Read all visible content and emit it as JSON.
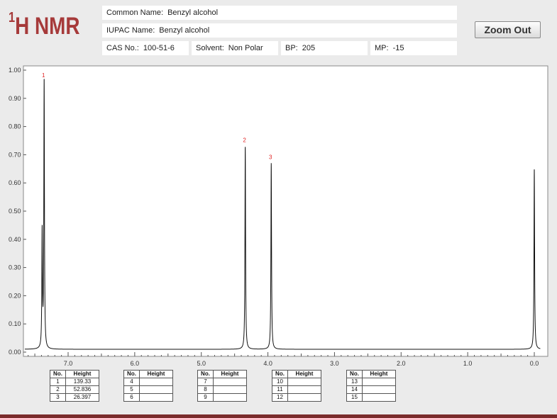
{
  "header": {
    "logo_sup": "1",
    "logo_text": "H NMR",
    "common_name_label": "Common Name:",
    "common_name": "Benzyl alcohol",
    "iupac_label": "IUPAC Name:",
    "iupac_name": "Benzyl alcohol",
    "cas_label": "CAS No.:",
    "cas": "100-51-6",
    "solvent_label": "Solvent:",
    "solvent": "Non Polar",
    "bp_label": "BP:",
    "bp": "205",
    "mp_label": "MP:",
    "mp": "-15",
    "zoom_out_label": "Zoom Out"
  },
  "chart_data": {
    "type": "line",
    "x_axis_reversed": true,
    "xlim": [
      7.7,
      -0.1
    ],
    "ylim": [
      0,
      1.0
    ],
    "x_ticks": [
      7.0,
      6.0,
      5.0,
      4.0,
      3.0,
      2.0,
      1.0,
      0.0
    ],
    "x_tick_labels": [
      "7.0",
      "6.0",
      "5.0",
      "4.0",
      "3.0",
      "2.0",
      "1.0",
      "0.0"
    ],
    "y_ticks": [
      0.0,
      0.1,
      0.2,
      0.3,
      0.4,
      0.5,
      0.6,
      0.7,
      0.8,
      0.9,
      1.0
    ],
    "y_tick_labels": [
      "0.00",
      "0.10",
      "0.20",
      "0.30",
      "0.40",
      "0.50",
      "0.60",
      "0.70",
      "0.80",
      "0.90",
      "1.00"
    ],
    "peaks": [
      {
        "ppm": 7.36,
        "height": 0.96,
        "label": "1",
        "shoulders": [
          {
            "ppm": 7.39,
            "height": 0.42
          }
        ]
      },
      {
        "ppm": 4.34,
        "height": 0.73,
        "label": "2"
      },
      {
        "ppm": 3.95,
        "height": 0.67,
        "label": "3"
      },
      {
        "ppm": 0.0,
        "height": 0.65
      }
    ],
    "baseline": 0.01,
    "line_color": "#111111",
    "peak_label_color": "#e02020"
  },
  "tables": [
    {
      "header_no": "No.",
      "header_height": "Height",
      "rows": [
        [
          "1",
          "139.33"
        ],
        [
          "2",
          "52.836"
        ],
        [
          "3",
          "26.397"
        ]
      ]
    },
    {
      "header_no": "No.",
      "header_height": "Height",
      "rows": [
        [
          "4",
          ""
        ],
        [
          "5",
          ""
        ],
        [
          "6",
          ""
        ]
      ]
    },
    {
      "header_no": "No.",
      "header_height": "Height",
      "rows": [
        [
          "7",
          ""
        ],
        [
          "8",
          ""
        ],
        [
          "9",
          ""
        ]
      ]
    },
    {
      "header_no": "No.",
      "header_height": "Height",
      "rows": [
        [
          "10",
          ""
        ],
        [
          "11",
          ""
        ],
        [
          "12",
          ""
        ]
      ]
    },
    {
      "header_no": "No.",
      "header_height": "Height",
      "rows": [
        [
          "13",
          ""
        ],
        [
          "14",
          ""
        ],
        [
          "15",
          ""
        ]
      ]
    }
  ],
  "colors": {
    "logo": "#a63a3a",
    "background": "#ebebeb",
    "bottom_bar": "#7a2b2b"
  }
}
